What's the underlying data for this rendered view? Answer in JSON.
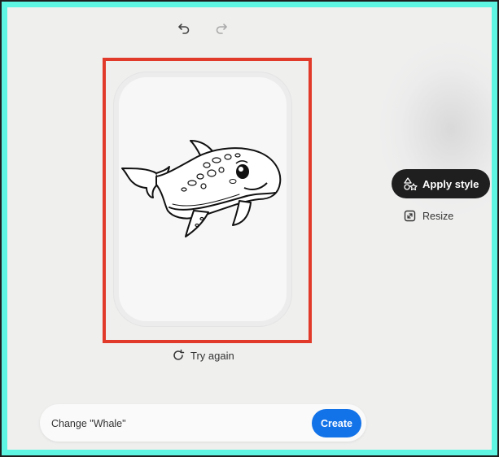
{
  "toolbar": {
    "undo_icon": "undo-icon",
    "redo_icon": "redo-icon"
  },
  "image": {
    "subject": "whale-illustration"
  },
  "actions": {
    "try_again_label": "Try again",
    "apply_style_label": "Apply style",
    "resize_label": "Resize"
  },
  "prompt": {
    "value": "Change \"Whale\"",
    "create_label": "Create"
  },
  "colors": {
    "accent": "#1272e8",
    "highlight": "#e23a2a",
    "frame": "#5ff5e3",
    "dark_button": "#1f1f1f"
  }
}
